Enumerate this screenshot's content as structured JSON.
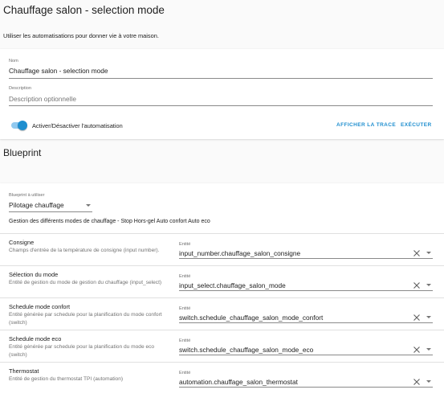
{
  "page": {
    "title": "Chauffage salon - selection mode",
    "intro": "Utiliser les automatisations pour donner vie à votre maison."
  },
  "automation": {
    "name_label": "Nom",
    "name_value": "Chauffage salon - selection mode",
    "description_label": "Description",
    "description_placeholder": "Description optionnelle",
    "toggle_label": "Activer/Désactiver l'automatisation",
    "toggle_on": true,
    "trace_button": "AFFICHER LA TRACE",
    "execute_button": "EXÉCUTER"
  },
  "blueprint": {
    "heading": "Blueprint",
    "select_label": "Blueprint à utiliser",
    "select_value": "Pilotage chauffage",
    "description": "Gestion des différents modes de chauffage - Stop Hors-gel Auto confort Auto eco",
    "entity_label": "Entité",
    "inputs": [
      {
        "title": "Consigne",
        "description": "Champs d'entrée de la température de consigne (input number).",
        "entity": "input_number.chauffage_salon_consigne"
      },
      {
        "title": "Sélection du mode",
        "description": "Entité de gestion du mode de gestion du chauffage (input_select)",
        "entity": "input_select.chauffage_salon_mode"
      },
      {
        "title": "Schedule mode confort",
        "description": "Entité générée par schedule pour la planification du mode confort (switch)",
        "entity": "switch.schedule_chauffage_salon_mode_confort"
      },
      {
        "title": "Schedule mode eco",
        "description": "Entité générée par schedule pour la planification du mode eco (switch)",
        "entity": "switch.schedule_chauffage_salon_mode_eco"
      },
      {
        "title": "Thermostat",
        "description": "Entité de gestion du thermostat TPI (automation)",
        "entity": "automation.chauffage_salon_thermostat"
      }
    ]
  },
  "colors": {
    "accent": "#1e8ecf",
    "toggle_track": "#91c9ef"
  },
  "icons": {
    "clear": "close-icon",
    "dropdown": "menu-down-icon"
  }
}
